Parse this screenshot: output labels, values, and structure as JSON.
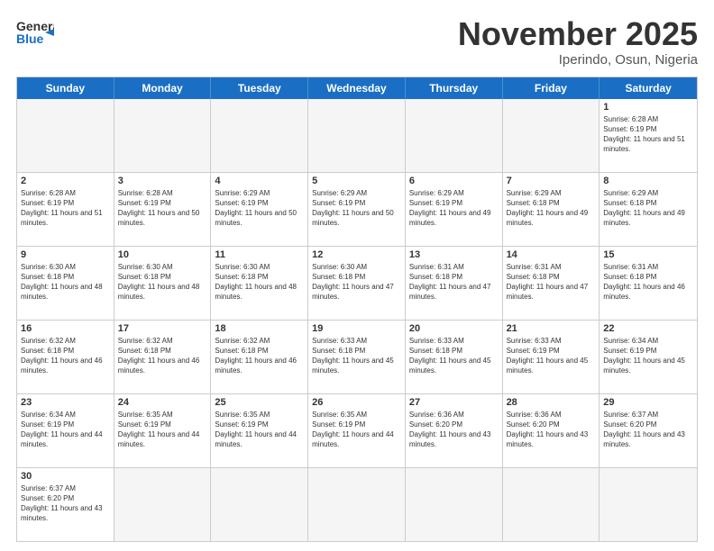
{
  "header": {
    "logo_general": "General",
    "logo_blue": "Blue",
    "month_title": "November 2025",
    "location": "Iperindo, Osun, Nigeria"
  },
  "weekdays": [
    "Sunday",
    "Monday",
    "Tuesday",
    "Wednesday",
    "Thursday",
    "Friday",
    "Saturday"
  ],
  "rows": [
    [
      {
        "day": "",
        "empty": true
      },
      {
        "day": "",
        "empty": true
      },
      {
        "day": "",
        "empty": true
      },
      {
        "day": "",
        "empty": true
      },
      {
        "day": "",
        "empty": true
      },
      {
        "day": "",
        "empty": true
      },
      {
        "day": "1",
        "sunrise": "6:28 AM",
        "sunset": "6:19 PM",
        "daylight": "11 hours and 51 minutes."
      }
    ],
    [
      {
        "day": "2",
        "sunrise": "6:28 AM",
        "sunset": "6:19 PM",
        "daylight": "11 hours and 51 minutes."
      },
      {
        "day": "3",
        "sunrise": "6:28 AM",
        "sunset": "6:19 PM",
        "daylight": "11 hours and 50 minutes."
      },
      {
        "day": "4",
        "sunrise": "6:29 AM",
        "sunset": "6:19 PM",
        "daylight": "11 hours and 50 minutes."
      },
      {
        "day": "5",
        "sunrise": "6:29 AM",
        "sunset": "6:19 PM",
        "daylight": "11 hours and 50 minutes."
      },
      {
        "day": "6",
        "sunrise": "6:29 AM",
        "sunset": "6:19 PM",
        "daylight": "11 hours and 49 minutes."
      },
      {
        "day": "7",
        "sunrise": "6:29 AM",
        "sunset": "6:18 PM",
        "daylight": "11 hours and 49 minutes."
      },
      {
        "day": "8",
        "sunrise": "6:29 AM",
        "sunset": "6:18 PM",
        "daylight": "11 hours and 49 minutes."
      }
    ],
    [
      {
        "day": "9",
        "sunrise": "6:30 AM",
        "sunset": "6:18 PM",
        "daylight": "11 hours and 48 minutes."
      },
      {
        "day": "10",
        "sunrise": "6:30 AM",
        "sunset": "6:18 PM",
        "daylight": "11 hours and 48 minutes."
      },
      {
        "day": "11",
        "sunrise": "6:30 AM",
        "sunset": "6:18 PM",
        "daylight": "11 hours and 48 minutes."
      },
      {
        "day": "12",
        "sunrise": "6:30 AM",
        "sunset": "6:18 PM",
        "daylight": "11 hours and 47 minutes."
      },
      {
        "day": "13",
        "sunrise": "6:31 AM",
        "sunset": "6:18 PM",
        "daylight": "11 hours and 47 minutes."
      },
      {
        "day": "14",
        "sunrise": "6:31 AM",
        "sunset": "6:18 PM",
        "daylight": "11 hours and 47 minutes."
      },
      {
        "day": "15",
        "sunrise": "6:31 AM",
        "sunset": "6:18 PM",
        "daylight": "11 hours and 46 minutes."
      }
    ],
    [
      {
        "day": "16",
        "sunrise": "6:32 AM",
        "sunset": "6:18 PM",
        "daylight": "11 hours and 46 minutes."
      },
      {
        "day": "17",
        "sunrise": "6:32 AM",
        "sunset": "6:18 PM",
        "daylight": "11 hours and 46 minutes."
      },
      {
        "day": "18",
        "sunrise": "6:32 AM",
        "sunset": "6:18 PM",
        "daylight": "11 hours and 46 minutes."
      },
      {
        "day": "19",
        "sunrise": "6:33 AM",
        "sunset": "6:18 PM",
        "daylight": "11 hours and 45 minutes."
      },
      {
        "day": "20",
        "sunrise": "6:33 AM",
        "sunset": "6:18 PM",
        "daylight": "11 hours and 45 minutes."
      },
      {
        "day": "21",
        "sunrise": "6:33 AM",
        "sunset": "6:19 PM",
        "daylight": "11 hours and 45 minutes."
      },
      {
        "day": "22",
        "sunrise": "6:34 AM",
        "sunset": "6:19 PM",
        "daylight": "11 hours and 45 minutes."
      }
    ],
    [
      {
        "day": "23",
        "sunrise": "6:34 AM",
        "sunset": "6:19 PM",
        "daylight": "11 hours and 44 minutes."
      },
      {
        "day": "24",
        "sunrise": "6:35 AM",
        "sunset": "6:19 PM",
        "daylight": "11 hours and 44 minutes."
      },
      {
        "day": "25",
        "sunrise": "6:35 AM",
        "sunset": "6:19 PM",
        "daylight": "11 hours and 44 minutes."
      },
      {
        "day": "26",
        "sunrise": "6:35 AM",
        "sunset": "6:19 PM",
        "daylight": "11 hours and 44 minutes."
      },
      {
        "day": "27",
        "sunrise": "6:36 AM",
        "sunset": "6:20 PM",
        "daylight": "11 hours and 43 minutes."
      },
      {
        "day": "28",
        "sunrise": "6:36 AM",
        "sunset": "6:20 PM",
        "daylight": "11 hours and 43 minutes."
      },
      {
        "day": "29",
        "sunrise": "6:37 AM",
        "sunset": "6:20 PM",
        "daylight": "11 hours and 43 minutes."
      }
    ],
    [
      {
        "day": "30",
        "sunrise": "6:37 AM",
        "sunset": "6:20 PM",
        "daylight": "11 hours and 43 minutes."
      },
      {
        "day": "",
        "empty": true
      },
      {
        "day": "",
        "empty": true
      },
      {
        "day": "",
        "empty": true
      },
      {
        "day": "",
        "empty": true
      },
      {
        "day": "",
        "empty": true
      },
      {
        "day": "",
        "empty": true
      }
    ]
  ]
}
